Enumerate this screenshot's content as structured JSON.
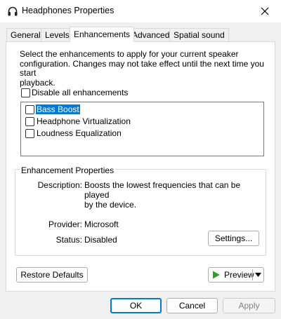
{
  "window": {
    "title": "Headphones Properties",
    "icon": "headphones-icon",
    "close_icon": "close-icon"
  },
  "tabs": [
    {
      "label": "General",
      "active": false
    },
    {
      "label": "Levels",
      "active": false
    },
    {
      "label": "Enhancements",
      "active": true
    },
    {
      "label": "Advanced",
      "active": false
    },
    {
      "label": "Spatial sound",
      "active": false
    }
  ],
  "enhancements": {
    "description_lines": [
      "Select the enhancements to apply for your current speaker",
      "configuration. Changes may not take effect until the next time you start",
      "playback."
    ],
    "disable_all": {
      "label": "Disable all enhancements",
      "checked": false
    },
    "items": [
      {
        "label": "Bass Boost",
        "checked": false,
        "selected": true
      },
      {
        "label": "Headphone Virtualization",
        "checked": false,
        "selected": false
      },
      {
        "label": "Loudness Equalization",
        "checked": false,
        "selected": false
      }
    ]
  },
  "properties": {
    "group_title": "Enhancement Properties",
    "description_label": "Description:",
    "description_lines": [
      "Boosts the lowest frequencies that can be played",
      "by the device."
    ],
    "provider_label": "Provider:",
    "provider_value": "Microsoft",
    "status_label": "Status:",
    "status_value": "Disabled",
    "settings_button": "Settings..."
  },
  "buttons": {
    "restore_defaults": "Restore Defaults",
    "preview": "Preview",
    "ok": "OK",
    "cancel": "Cancel",
    "apply": "Apply"
  },
  "colors": {
    "selection": "#0078d7",
    "preview_play": "#2e9e2e",
    "default_button_border": "#0078d7"
  }
}
